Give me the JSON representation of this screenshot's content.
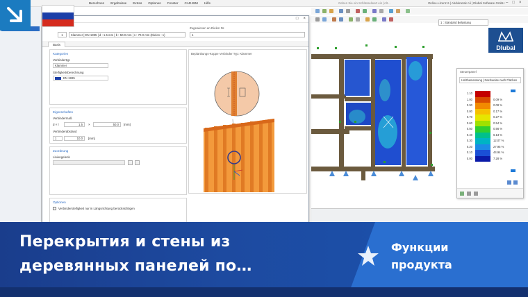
{
  "app": {
    "menu": [
      "Berechnen",
      "Ergebnisse",
      "Extras",
      "Optionen",
      "Fenster",
      "CAD-BIM",
      "Hilfe"
    ],
    "search_placeholder": "Geben Sie ein Schlüsselwort ein (Alt...",
    "license": "Online-Lizenz 6 | Abdulrazak Ali | Dlubal Software GmbH",
    "load_case": "1 : Standard Belastung"
  },
  "navigator": {
    "selected_item": "Klammer | EN 1995 | d : 1.5 mm"
  },
  "dialog": {
    "no": "1",
    "description": "Klammer | EN 1995 | d : 1.5 mm | b : 50.0 mm | s : 70.0 mm (Dielen : 1)",
    "assigned_label": "Zugewiesen an Dielen Nr.",
    "assigned_value": "1",
    "tab": "Basis",
    "categories": {
      "title": "Kategorien",
      "type_label": "Verbindertyp",
      "type_value": "Klammer",
      "design_label": "Steifigkeitsberechnung",
      "design_value": "EN 1995"
    },
    "properties": {
      "title": "Eigenschaften",
      "dims_label": "Verbindermaß",
      "d_label": "d × l",
      "d_value": "1.5",
      "l_value": "50.0",
      "unit_mm": "[mm]",
      "times": "×",
      "spacing_label": "Verbinderabstand",
      "count_value": "1",
      "spacing_value": "10.0"
    },
    "assignment": {
      "title": "Zuordnung",
      "sub_label": "Liniengelenk"
    },
    "options": {
      "title": "Optionen",
      "checkbox_label": "Verbindersteifigkeit nur in Längsrichtung berücksichtigen"
    },
    "preview_title": "Beplankungs-Koppe Verbinder Typ: Klammer"
  },
  "control_panel": {
    "title": "Steuerpanel",
    "subtitle": "Holzbemessung | Nachweise nach Flächen",
    "legend": [
      {
        "value": "1.10",
        "percent": "",
        "color": "#c40000"
      },
      {
        "value": "1.00",
        "percent": "0.09 %",
        "color": "#d94c00"
      },
      {
        "value": "0.90",
        "percent": "0.08 %",
        "color": "#f28a00"
      },
      {
        "value": "0.80",
        "percent": "0.17 %",
        "color": "#f6c000"
      },
      {
        "value": "0.70",
        "percent": "0.27 %",
        "color": "#e6e600"
      },
      {
        "value": "0.60",
        "percent": "0.54 %",
        "color": "#9fe100"
      },
      {
        "value": "0.50",
        "percent": "0.56 %",
        "color": "#2fcf2f"
      },
      {
        "value": "0.40",
        "percent": "6.13 %",
        "color": "#00c08c"
      },
      {
        "value": "0.30",
        "percent": "12.07 %",
        "color": "#00b4c4"
      },
      {
        "value": "0.20",
        "percent": "27.95 %",
        "color": "#1c8ce6"
      },
      {
        "value": "0.10",
        "percent": "44.94 %",
        "color": "#1a4fd6"
      },
      {
        "value": "0.00",
        "percent": "7.28 %",
        "color": "#0a1aa8"
      }
    ]
  },
  "logo": {
    "text": "Dlubal"
  },
  "banner": {
    "title_line1": "Перекрытия и стены из",
    "title_line2": "деревянных панелей по…",
    "category_line1": "Функции",
    "category_line2": "продукта"
  },
  "colors": {
    "banner_dark": "#1a3d8c",
    "banner_light": "#2a6fd0",
    "flag_white": "#ffffff",
    "flag_blue": "#1c3fa8",
    "flag_red": "#d52b1e",
    "timber": "#f08a2c"
  },
  "icons": [
    "arrow-down-right-icon",
    "flag-ru-icon",
    "star-icon",
    "dlubal-logo-icon"
  ]
}
